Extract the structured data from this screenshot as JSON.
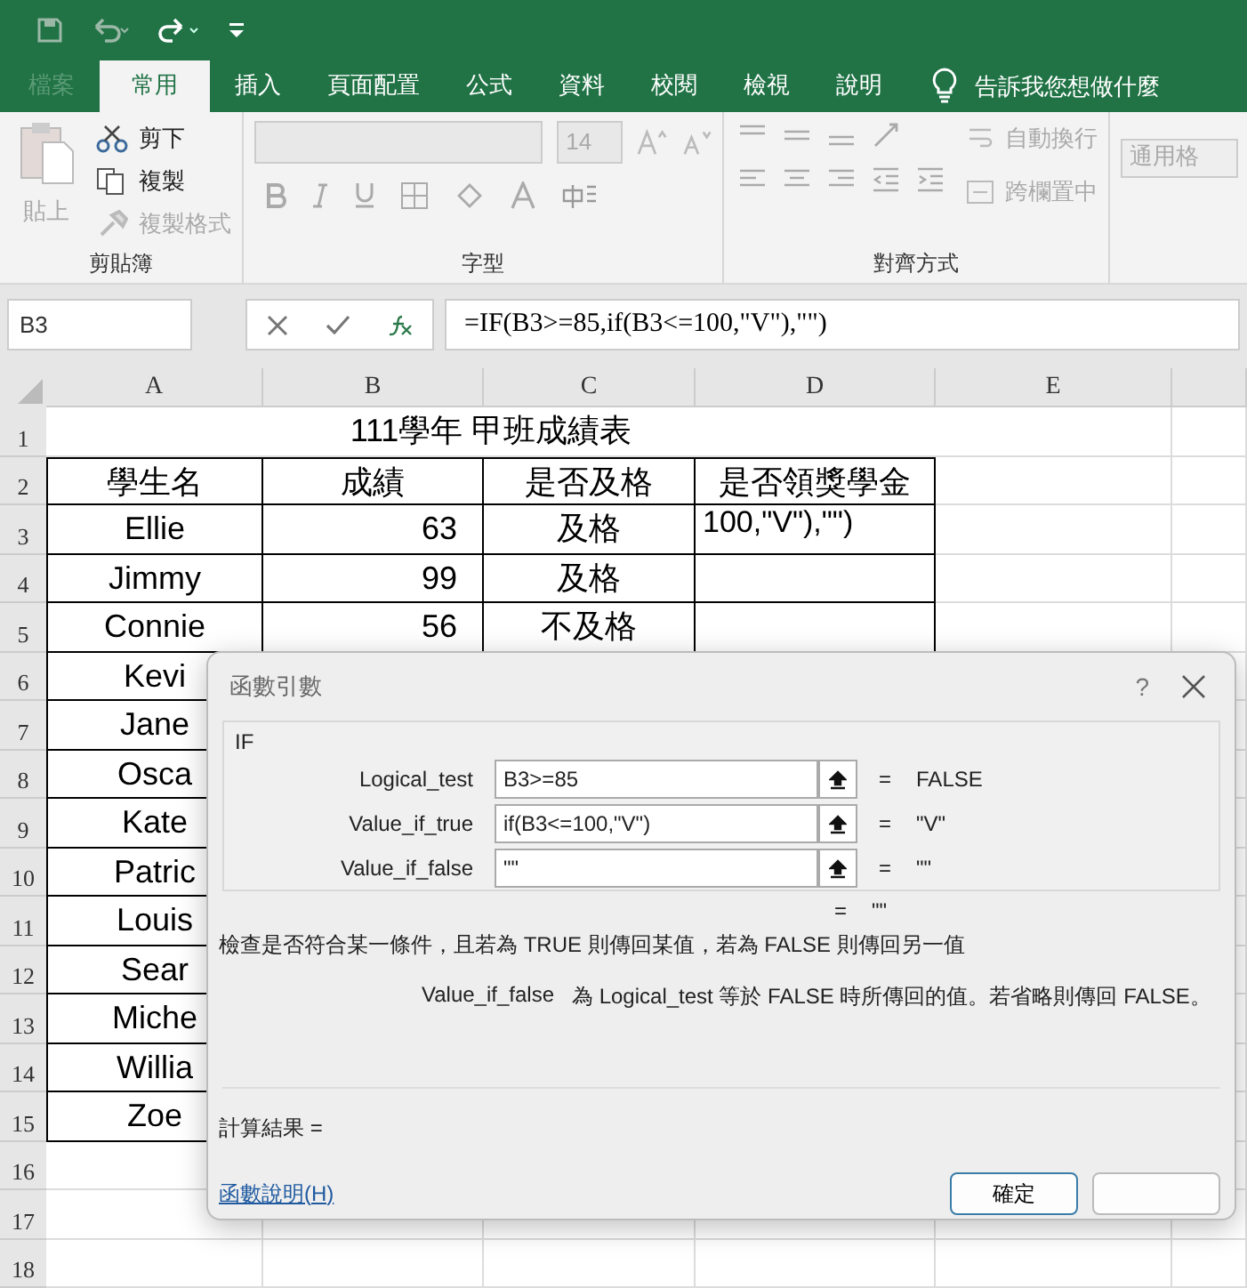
{
  "tabs": [
    {
      "label": "檔案",
      "selected": false,
      "disabled": true
    },
    {
      "label": "常用",
      "selected": true,
      "disabled": false
    },
    {
      "label": "插入",
      "selected": false,
      "disabled": false
    },
    {
      "label": "頁面配置",
      "selected": false,
      "disabled": false
    },
    {
      "label": "公式",
      "selected": false,
      "disabled": false
    },
    {
      "label": "資料",
      "selected": false,
      "disabled": false
    },
    {
      "label": "校閱",
      "selected": false,
      "disabled": false
    },
    {
      "label": "檢視",
      "selected": false,
      "disabled": false
    },
    {
      "label": "說明",
      "selected": false,
      "disabled": false
    }
  ],
  "tell_me": "告訴我您想做什麼",
  "ribbon": {
    "clipboard": {
      "label": "剪貼簿",
      "paste": "貼上",
      "cut": "剪下",
      "copy": "複製",
      "format_painter": "複製格式"
    },
    "font": {
      "label": "字型",
      "size": "14"
    },
    "alignment": {
      "label": "對齊方式",
      "wrap_text": "自動換行",
      "merge_center": "跨欄置中"
    },
    "number": {
      "format": "通用格"
    }
  },
  "formula_bar": {
    "name_box": "B3",
    "formula": "=IF(B3>=85,if(B3<=100,\"V\"),\"\")"
  },
  "sheet": {
    "columns": [
      "A",
      "B",
      "C",
      "D",
      "E"
    ],
    "rows": [
      {
        "number": "1",
        "kind": "title",
        "cells": [
          "111學年 甲班成績表"
        ]
      },
      {
        "number": "2",
        "kind": "header",
        "cells": [
          "學生名",
          "成績",
          "是否及格",
          "是否領獎學金"
        ]
      },
      {
        "number": "3",
        "kind": "record",
        "cells": [
          "Ellie",
          "63",
          "及格",
          "100,\"V\"),\"\")"
        ]
      },
      {
        "number": "4",
        "kind": "record",
        "cells": [
          "Jimmy",
          "99",
          "及格"
        ]
      },
      {
        "number": "5",
        "kind": "record",
        "cells": [
          "Connie",
          "56",
          "不及格"
        ]
      },
      {
        "number": "6",
        "kind": "record",
        "cells": [
          "Kevi"
        ]
      },
      {
        "number": "7",
        "kind": "record",
        "cells": [
          "Jane"
        ]
      },
      {
        "number": "8",
        "kind": "record",
        "cells": [
          "Osca"
        ]
      },
      {
        "number": "9",
        "kind": "record",
        "cells": [
          "Kate"
        ]
      },
      {
        "number": "10",
        "kind": "record",
        "cells": [
          "Patric"
        ]
      },
      {
        "number": "11",
        "kind": "record",
        "cells": [
          "Louis"
        ]
      },
      {
        "number": "12",
        "kind": "record",
        "cells": [
          "Sear"
        ]
      },
      {
        "number": "13",
        "kind": "record",
        "cells": [
          "Miche"
        ]
      },
      {
        "number": "14",
        "kind": "record",
        "cells": [
          "Willia"
        ]
      },
      {
        "number": "15",
        "kind": "record",
        "cells": [
          "Zoe"
        ]
      },
      {
        "number": "16",
        "kind": "empty"
      },
      {
        "number": "17",
        "kind": "empty"
      },
      {
        "number": "18",
        "kind": "empty"
      }
    ]
  },
  "dialog": {
    "title": "函數引數",
    "help": "?",
    "function": "IF",
    "arguments": [
      {
        "name": "Logical_test",
        "value": "B3>=85",
        "equals": "=",
        "result": "FALSE"
      },
      {
        "name": "Value_if_true",
        "value": "if(B3<=100,\"V\")",
        "equals": "=",
        "result": "\"V\""
      },
      {
        "name": "Value_if_false",
        "value": "\"\"",
        "equals": "=",
        "result": "\"\""
      }
    ],
    "formula_result": {
      "equals": "=",
      "value": "\"\""
    },
    "description": "檢查是否符合某一條件，且若為 TRUE 則傳回某值，若為 FALSE 則傳回另一值",
    "argument_name": "Value_if_false",
    "argument_help": "為 Logical_test 等於 FALSE 時所傳回的值。若省略則傳回 FALSE。",
    "result_label": "計算結果 =",
    "help_link": "函數說明(H)",
    "buttons": [
      {
        "label": "確定",
        "kind": "ok"
      },
      {
        "kind": "cancel"
      }
    ]
  }
}
